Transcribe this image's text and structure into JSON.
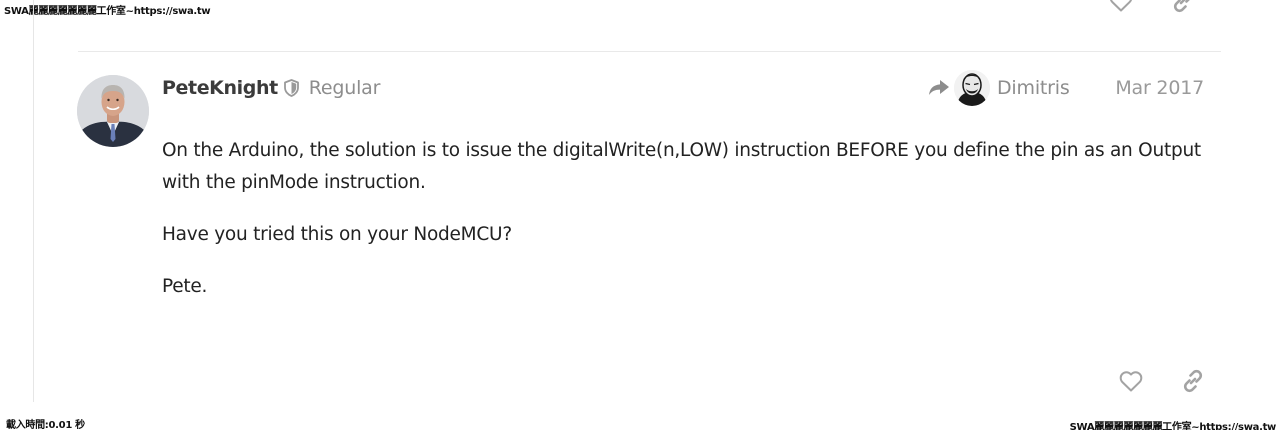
{
  "watermarks": {
    "top_left": "SWA麗麗麗麗麗麗麗工作室~https://swa.tw",
    "bottom_left": "載入時間:0.01 秒",
    "bottom_right": "SWA麗麗麗麗麗麗麗工作室~https://swa.tw"
  },
  "post": {
    "author": "PeteKnight",
    "author_title": "Regular",
    "reply_to": "Dimitris",
    "date": "Mar 2017",
    "paragraphs": [
      "On the Arduino, the solution is to issue the digitalWrite(n,LOW) instruction BEFORE you define the pin as an Output with the pinMode instruction.",
      "Have you tried this on your NodeMCU?",
      "Pete."
    ]
  },
  "icons": {
    "like": "heart-icon",
    "share": "link-icon",
    "moderator": "shield-icon",
    "reply": "reply-arrow-icon"
  },
  "colors": {
    "icon": "#9a9a9a",
    "username": "#3b3b3b",
    "muted": "#8d8d8d"
  }
}
